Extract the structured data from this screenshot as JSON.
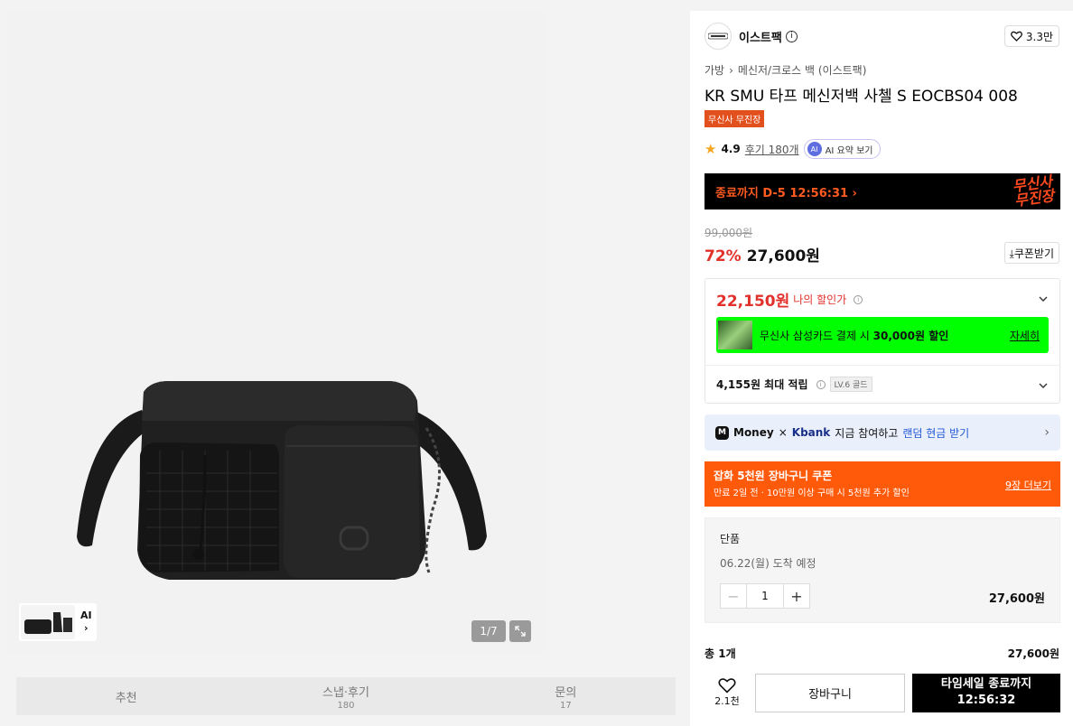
{
  "gallery": {
    "counter": "1/7",
    "thumb_ai": "AI"
  },
  "tabs": [
    {
      "label": "추천",
      "count": ""
    },
    {
      "label": "스냅·후기",
      "count": "180"
    },
    {
      "label": "문의",
      "count": "17"
    }
  ],
  "brand": {
    "name": "이스트팩",
    "likes": "3.3만"
  },
  "breadcrumb": [
    "가방",
    "메신저/크로스 백 (이스트팩)"
  ],
  "product": {
    "title": "KR SMU 타프 메신저백 사첼 S EOCBS04 008",
    "tag": "무신사 무진장",
    "rating": "4.9",
    "reviews": "후기 180개",
    "ai_summary": "AI 요약 보기"
  },
  "timer_banner": {
    "text": "종료까지 D-5 12:56:31 ›",
    "logo_line1": "무신사",
    "logo_line2": "무진장"
  },
  "pricing": {
    "original": "99,000원",
    "discount": "72%",
    "price": "27,600원",
    "coupon_btn": "⤓쿠폰받기"
  },
  "benefits": {
    "my_price": "22,150원",
    "my_price_label": "나의 할인가",
    "card_text_pre": "무신사 삼성카드 결제 시 ",
    "card_text_bold": "30,000원 할인",
    "card_link": "자세히",
    "points": "4,155원 최대 적립",
    "level": "LV.6 골드"
  },
  "kbank": {
    "money": "Money",
    "x": "×",
    "kbank": "Kbank",
    "text": "지금 참여하고",
    "highlight": "랜덤 현금 받기"
  },
  "coupon_banner": {
    "title": "잡화 5천원 장바구니 쿠폰",
    "subtitle": "만료 2일 전 · 10만원 이상 구매 시 5천원 추가 할인",
    "link": "9장 더보기"
  },
  "option": {
    "name": "단품",
    "arrival": "06.22(월) 도착 예정",
    "quantity": "1",
    "price": "27,600원"
  },
  "total": {
    "label": "총 1개",
    "price": "27,600원"
  },
  "bottom": {
    "wish_count": "2.1천",
    "cart": "장바구니",
    "buy_line1": "타임세일 종료까지",
    "buy_line2": "12:56:32"
  }
}
